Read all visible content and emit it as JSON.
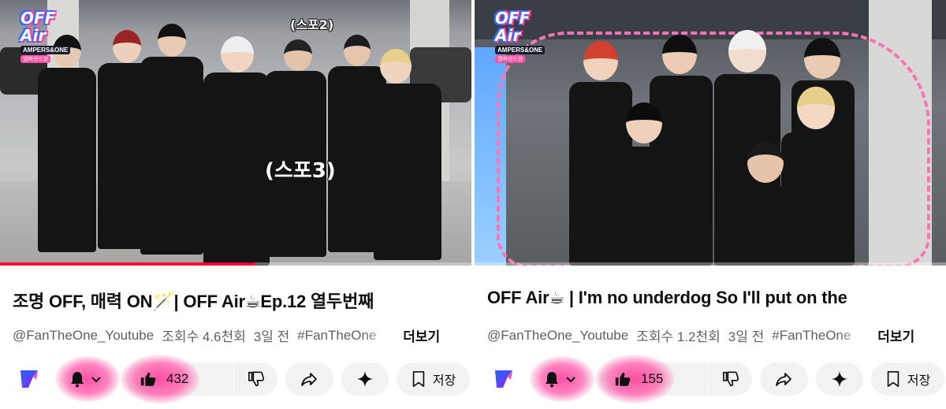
{
  "left": {
    "thumbnail": {
      "badge_title": "OFF Air",
      "badge_sub": "AMPERS&ONE",
      "badge_sub2": "앰퍼샌드원",
      "caption_1": "(스포2)",
      "caption_2": "(스포3)",
      "progress_fraction": 0.54
    },
    "title": "조명 OFF, 매력 ON🪄| OFF Air☕Ep.12 열두번째",
    "channel": "@FanTheOne_Youtube",
    "views": "조회수 4.6천회",
    "age": "3일 전",
    "hashtag": "#FanTheOne",
    "more": "더보기",
    "like_count": "432",
    "save_label": "저장"
  },
  "right": {
    "thumbnail": {
      "badge_title": "OFF Air",
      "badge_sub": "AMPERS&ONE",
      "badge_sub2": "앰퍼샌드원",
      "progress_fraction": 0.0
    },
    "title": "OFF Air☕ | I'm no underdog So I'll put on the",
    "channel": "@FanTheOne_Youtube",
    "views": "조회수 1.2천회",
    "age": "3일 전",
    "hashtag": "#FanTheOne",
    "more": "더보기",
    "like_count": "155",
    "save_label": "저장"
  },
  "icons": {
    "bell": "bell-icon",
    "chevron": "chevron-down-icon",
    "like": "thumbs-up-icon",
    "dislike": "thumbs-down-icon",
    "share": "share-icon",
    "remix": "sparkle-icon",
    "save": "bookmark-icon",
    "channel": "channel-logo"
  },
  "colors": {
    "accent_progress": "#ff0033",
    "highlight_pink": "#ff4fa3",
    "chip_bg": "#f2f2f2"
  }
}
